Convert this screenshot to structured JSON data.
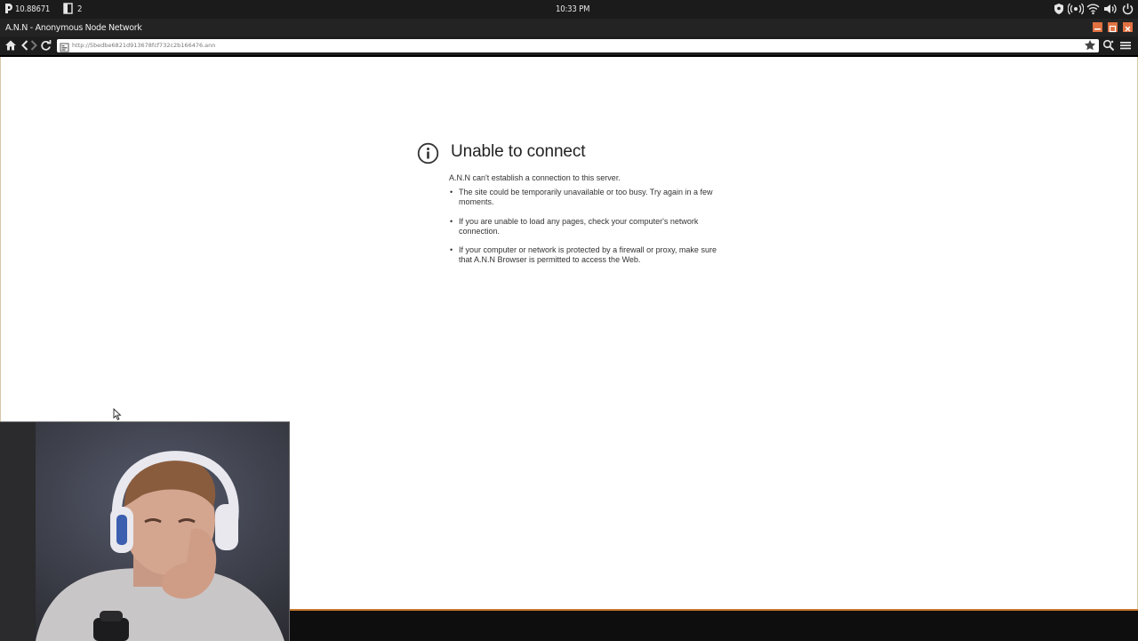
{
  "system_bar": {
    "balance": "10.88671",
    "workspace_count": "2",
    "time": "10:33 PM"
  },
  "window": {
    "title": "A.N.N - Anonymous Node Network"
  },
  "toolbar": {
    "url": "http://5bedbe6821d913678fcf732c2b166476.ann"
  },
  "error_page": {
    "title": "Unable to connect",
    "message": "A.N.N can't establish a connection to this server.",
    "tips": [
      "The site could be temporarily unavailable or too busy. Try again in a few moments.",
      "If you are unable to load any pages, check your computer's network connection.",
      "If your computer or network is protected by a firewall or proxy, make sure that A.N.N Browser is permitted to access the Web."
    ]
  },
  "colors": {
    "accent": "#e07040",
    "statusline": "#c8772f",
    "chrome_dark": "#1d1d1d"
  }
}
